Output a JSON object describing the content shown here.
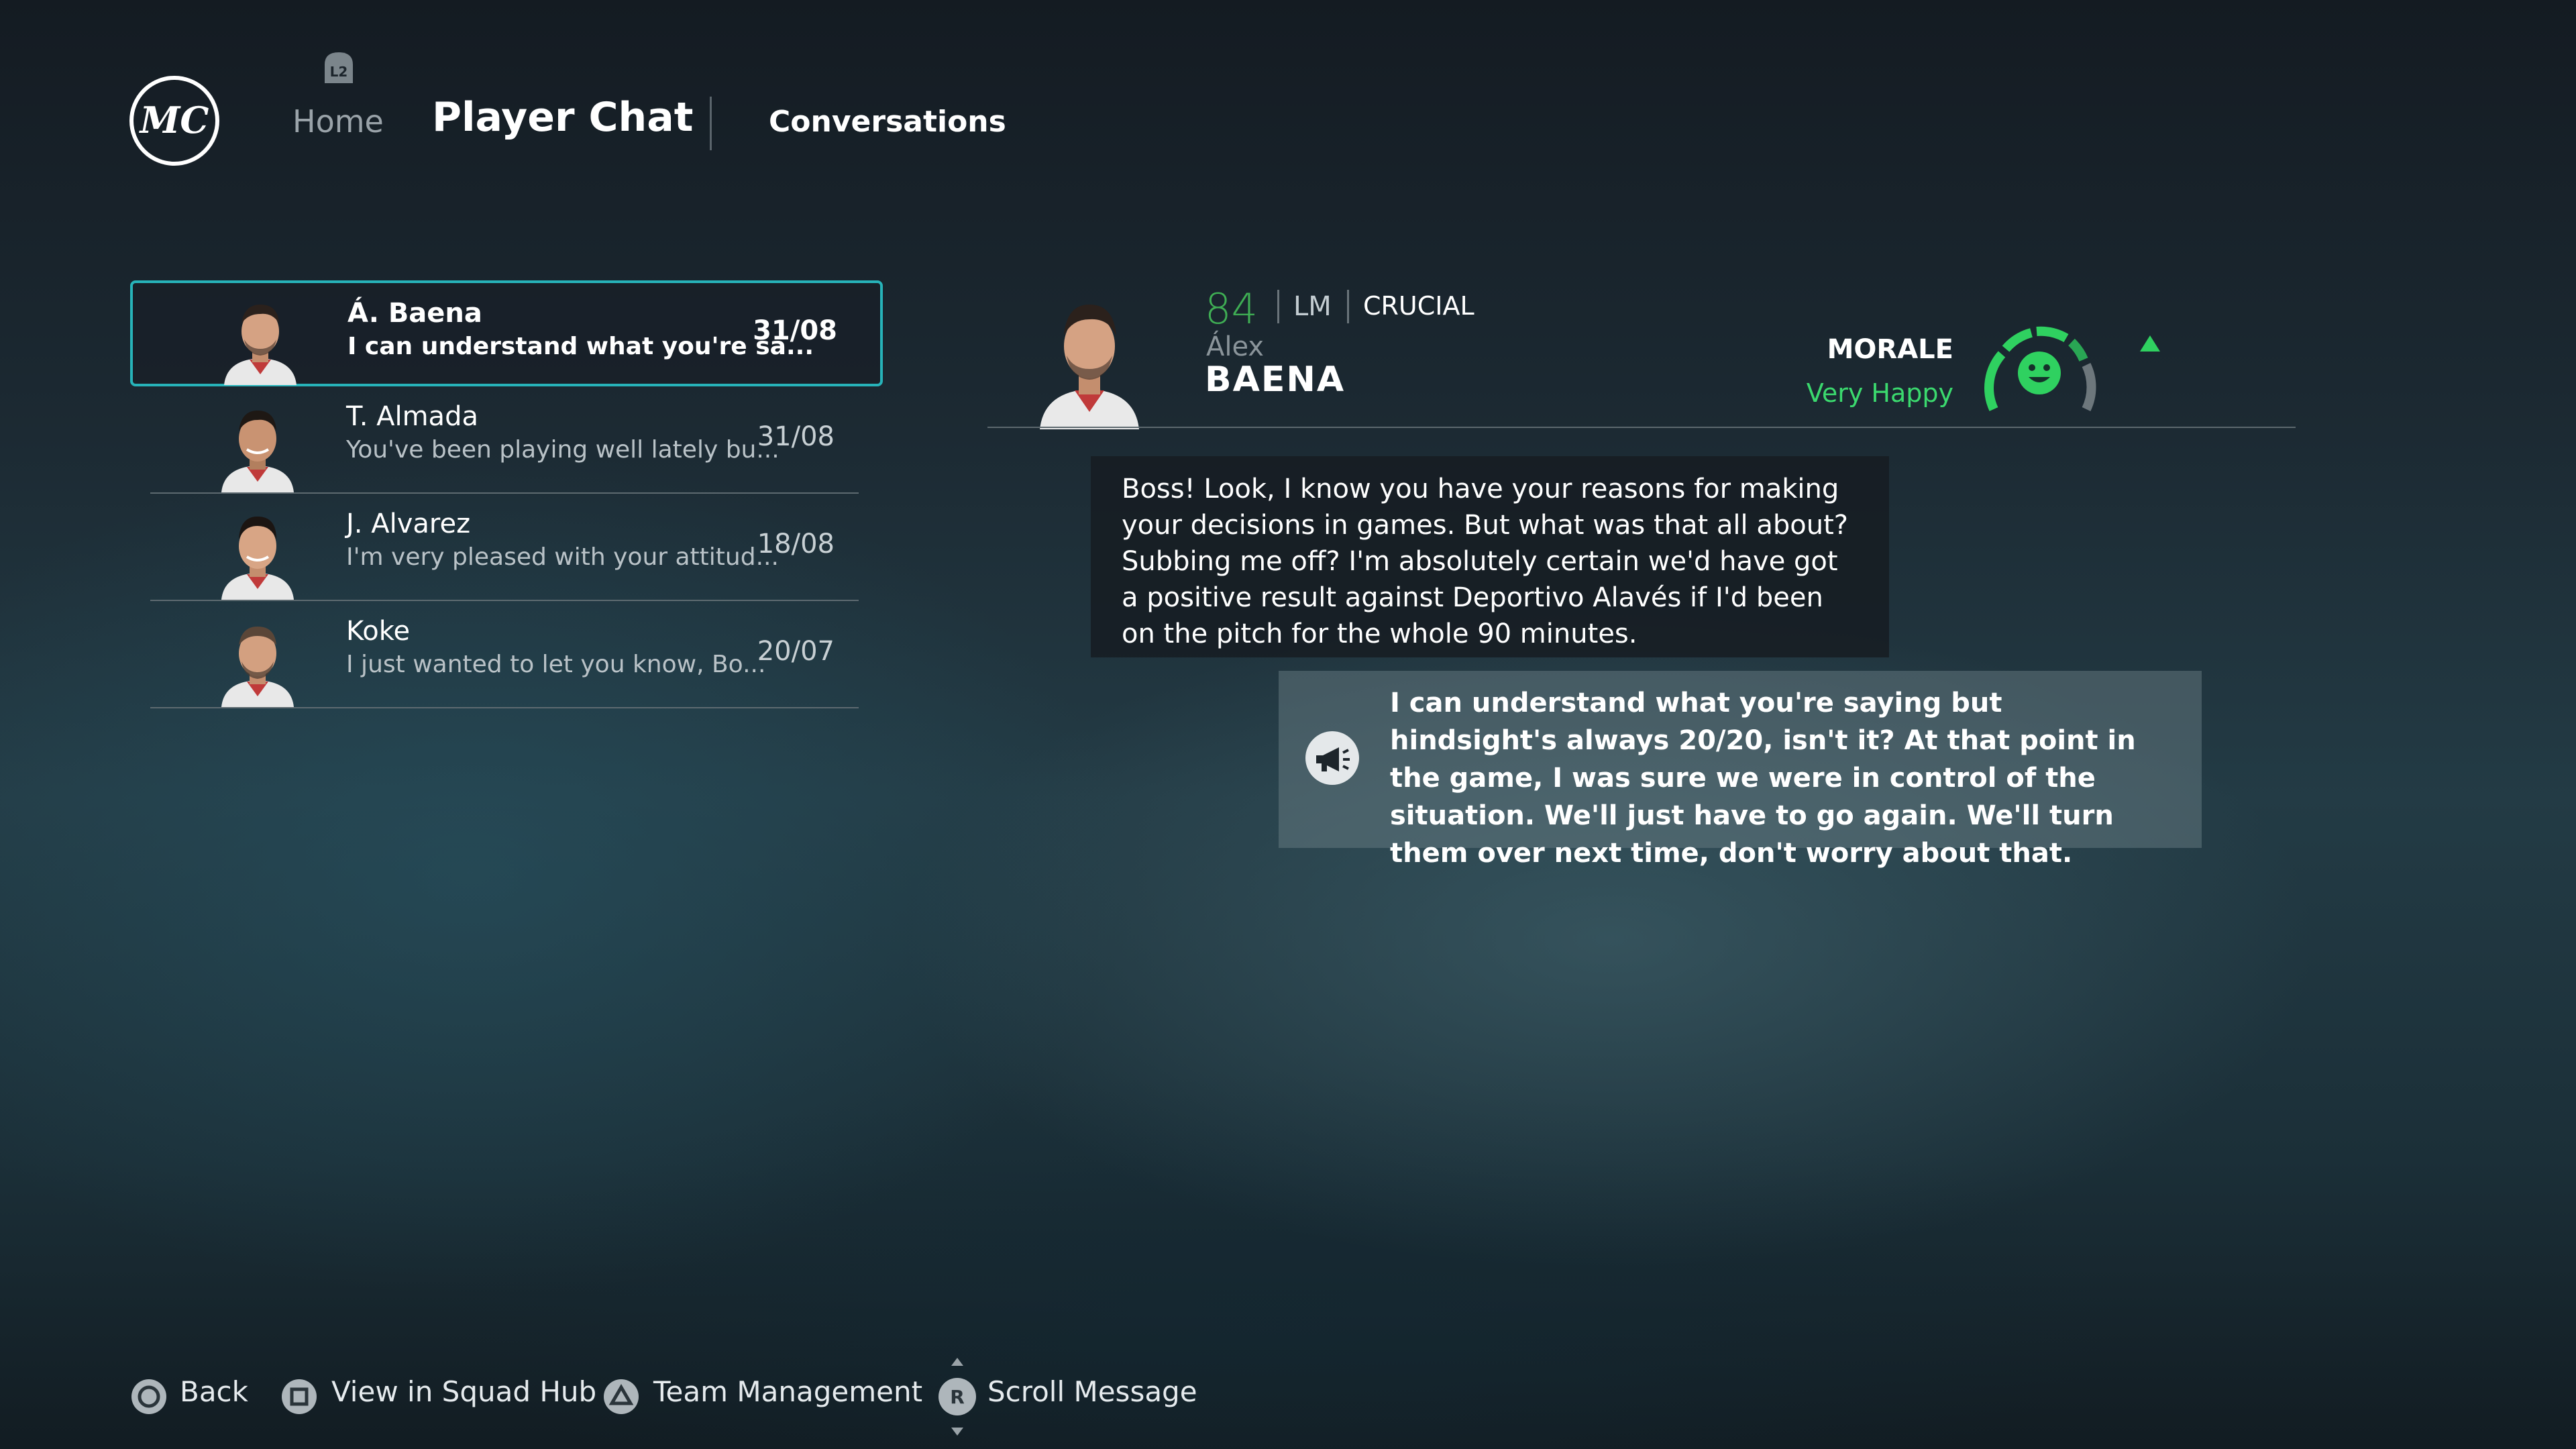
{
  "header": {
    "logo_text": "MC",
    "l2_badge": "L2",
    "home_label": "Home",
    "title": "Player Chat",
    "conversations_label": "Conversations"
  },
  "conversations": [
    {
      "name": "Á. Baena",
      "snippet": "I can understand what you're sa...",
      "date": "31/08",
      "active": true
    },
    {
      "name": "T. Almada",
      "snippet": "You've been playing well lately bu...",
      "date": "31/08",
      "active": false
    },
    {
      "name": "J. Alvarez",
      "snippet": "I'm very pleased with your attitud...",
      "date": "18/08",
      "active": false
    },
    {
      "name": "Koke",
      "snippet": "I just wanted to let you know, Bo...",
      "date": "20/07",
      "active": false
    }
  ],
  "player": {
    "rating": "84",
    "position": "LM",
    "role": "CRUCIAL",
    "first_name": "Álex",
    "last_name": "BAENA",
    "morale_label": "MORALE",
    "morale_value": "Very Happy",
    "morale_trend": "up"
  },
  "messages": {
    "player_message": "Boss! Look, I know you have your reasons for making your decisions in games. But what was that all about? Subbing me off? I'm absolutely certain we'd have got a positive result against Deportivo Alavés if I'd been on the pitch for the whole 90 minutes.",
    "manager_reply": "I can understand what you're saying but hindsight's always 20/20, isn't it? At that point in the game, I was sure we were in control of the situation. We'll just have to go again. We'll turn them over next time, don't worry about that.",
    "reply_icon": "megaphone-icon"
  },
  "prompts": {
    "back": "Back",
    "squad_hub": "View in Squad Hub",
    "team_management": "Team Management",
    "scroll_message": "Scroll Message",
    "r_stick": "R"
  },
  "colors": {
    "accent": "#27b3b9",
    "morale_green": "#3bd96e",
    "rating_green": "#3fae54"
  }
}
